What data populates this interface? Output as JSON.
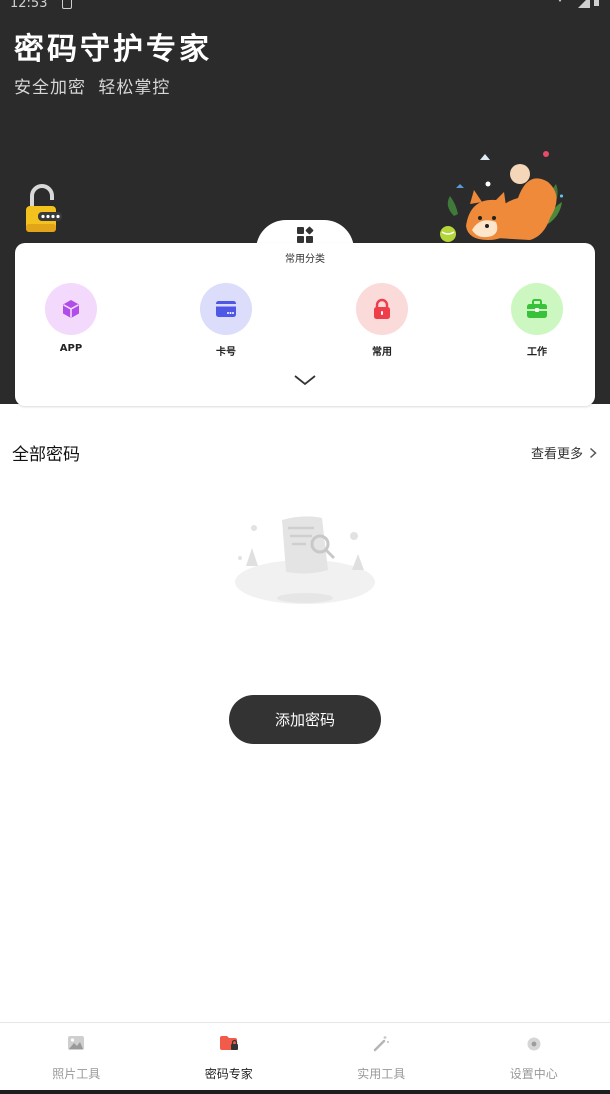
{
  "status_bar": {
    "time": "12:53"
  },
  "header": {
    "title": "密码守护专家",
    "subtitle": "安全加密  轻松掌控"
  },
  "categories": {
    "title": "常用分类",
    "items": [
      {
        "label": "APP",
        "color": "#f3d9fb",
        "icon_color": "#b04ce8",
        "icon": "cube-icon"
      },
      {
        "label": "卡号",
        "color": "#dcdcfb",
        "icon_color": "#4f58e6",
        "icon": "card-icon"
      },
      {
        "label": "常用",
        "color": "#fbdada",
        "icon_color": "#ef3d4a",
        "icon": "lock-icon"
      },
      {
        "label": "工作",
        "color": "#cdf7c0",
        "icon_color": "#38c23a",
        "icon": "briefcase-icon"
      }
    ]
  },
  "all_passwords": {
    "title": "全部密码",
    "more_label": "查看更多"
  },
  "add_button": {
    "label": "添加密码"
  },
  "tabbar": {
    "tabs": [
      {
        "label": "照片工具",
        "icon": "photo-icon",
        "active": false
      },
      {
        "label": "密码专家",
        "icon": "folder-lock-icon",
        "active": true
      },
      {
        "label": "实用工具",
        "icon": "magic-wand-icon",
        "active": false
      },
      {
        "label": "设置中心",
        "icon": "settings-icon",
        "active": false
      }
    ]
  }
}
